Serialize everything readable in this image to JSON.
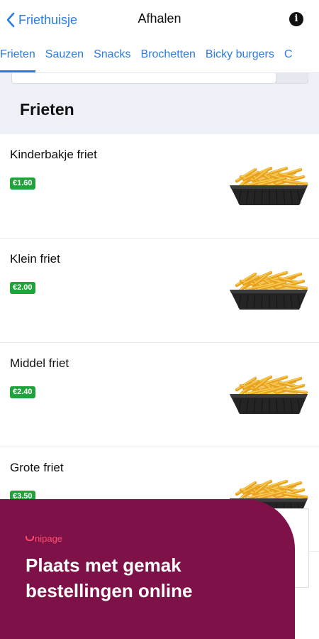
{
  "header": {
    "back_label": "Friethuisje",
    "title": "Afhalen",
    "info_glyph": "i"
  },
  "tabs": [
    {
      "label": "Frieten",
      "active": true
    },
    {
      "label": "Sauzen",
      "active": false
    },
    {
      "label": "Snacks",
      "active": false
    },
    {
      "label": "Brochetten",
      "active": false
    },
    {
      "label": "Bicky burgers",
      "active": false
    },
    {
      "label": "C",
      "active": false
    }
  ],
  "section": {
    "title": "Frieten"
  },
  "products": [
    {
      "name": "Kinderbakje friet",
      "price": "€1.60",
      "image": "fries-image"
    },
    {
      "name": "Klein friet",
      "price": "€2.00",
      "image": "fries-image"
    },
    {
      "name": "Middel friet",
      "price": "€2.40",
      "image": "fries-image"
    },
    {
      "name": "Grote friet",
      "price": "€3.50",
      "image": "fries-image"
    }
  ],
  "promo": {
    "brand": "nipage",
    "headline_line1": "Plaats met gemak",
    "headline_line2": "bestellingen online"
  },
  "colors": {
    "accent": "#2a7be4",
    "price_badge": "#1fa33a",
    "promo_bg": "#7d1148",
    "promo_brand": "#ff4d6d"
  }
}
